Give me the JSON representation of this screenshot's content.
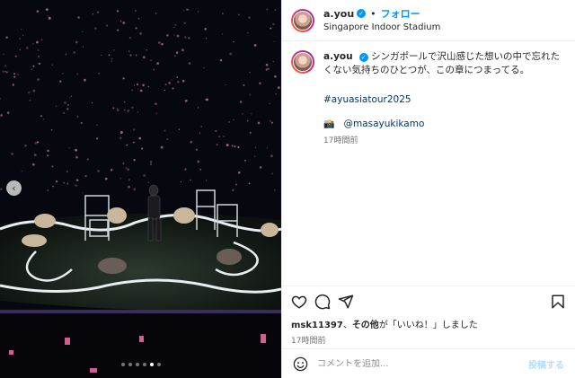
{
  "post": {
    "username": "a.you",
    "separator": "•",
    "follow_label": "フォロー",
    "location": "Singapore Indoor Stadium",
    "caption_text": "シンガポールで沢山感じた想いの中で忘れたくない気持ちのひとつが、この章につまってる。",
    "hashtag": "#ayuasiatour2025",
    "camera_emoji": "📸",
    "mention": "@masayukikamo",
    "caption_time": "17時間前",
    "likes_user": "msk11397",
    "likes_text": "、その他が「いいね！」しました",
    "likes_other": "その他",
    "post_time": "17時間前",
    "comment_placeholder": "コメントを追加...",
    "post_button": "投稿する",
    "verified_mark": "✓"
  },
  "media": {
    "prev_arrow": "‹",
    "carousel_count": 6,
    "carousel_active": 5
  },
  "icons": [
    "heart-icon",
    "comment-icon",
    "share-icon",
    "bookmark-icon",
    "emoji-icon"
  ],
  "colors": {
    "link": "#0095f6",
    "hashtag": "#00376b",
    "muted": "#737373"
  }
}
